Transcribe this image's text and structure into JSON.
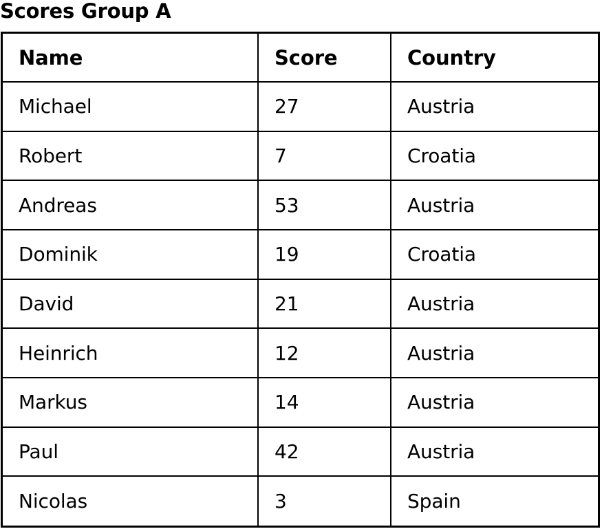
{
  "page": {
    "title": "Scores Group A",
    "background_color": "#ffffff",
    "text_color": "#000000",
    "border_color": "#000000"
  },
  "table": {
    "columns": [
      {
        "key": "name",
        "label": "Name"
      },
      {
        "key": "score",
        "label": "Score"
      },
      {
        "key": "country",
        "label": "Country"
      }
    ],
    "rows": [
      {
        "name": "Michael",
        "score": "27",
        "country": "Austria"
      },
      {
        "name": "Robert",
        "score": "7",
        "country": "Croatia"
      },
      {
        "name": "Andreas",
        "score": "53",
        "country": "Austria"
      },
      {
        "name": "Dominik",
        "score": "19",
        "country": "Croatia"
      },
      {
        "name": "David",
        "score": "21",
        "country": "Austria"
      },
      {
        "name": "Heinrich",
        "score": "12",
        "country": "Austria"
      },
      {
        "name": "Markus",
        "score": "14",
        "country": "Austria"
      },
      {
        "name": "Paul",
        "score": "42",
        "country": "Austria"
      },
      {
        "name": "Nicolas",
        "score": "3",
        "country": "Spain"
      }
    ]
  }
}
